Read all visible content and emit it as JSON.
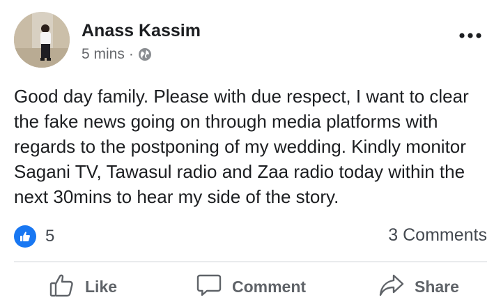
{
  "post": {
    "author": "Anass Kassim",
    "time": "5 mins",
    "separator": "·",
    "audience_icon": "globe-icon",
    "more_icon": "more-options-icon",
    "text": "Good day family. Please with due respect, I want to clear the fake news going on through media platforms with regards to the postponing of my wedding. Kindly monitor Sagani TV, Tawasul radio and Zaa radio today within the next 30mins to hear my side of the story."
  },
  "reactions": {
    "icon": "like-reaction-icon",
    "count": "5",
    "comments": "3 Comments"
  },
  "actions": {
    "like": "Like",
    "comment": "Comment",
    "share": "Share"
  },
  "colors": {
    "accent": "#1877f2",
    "text": "#1c1e21",
    "secondary": "#65676b",
    "action": "#5f6368",
    "divider": "#ccd0d5"
  }
}
